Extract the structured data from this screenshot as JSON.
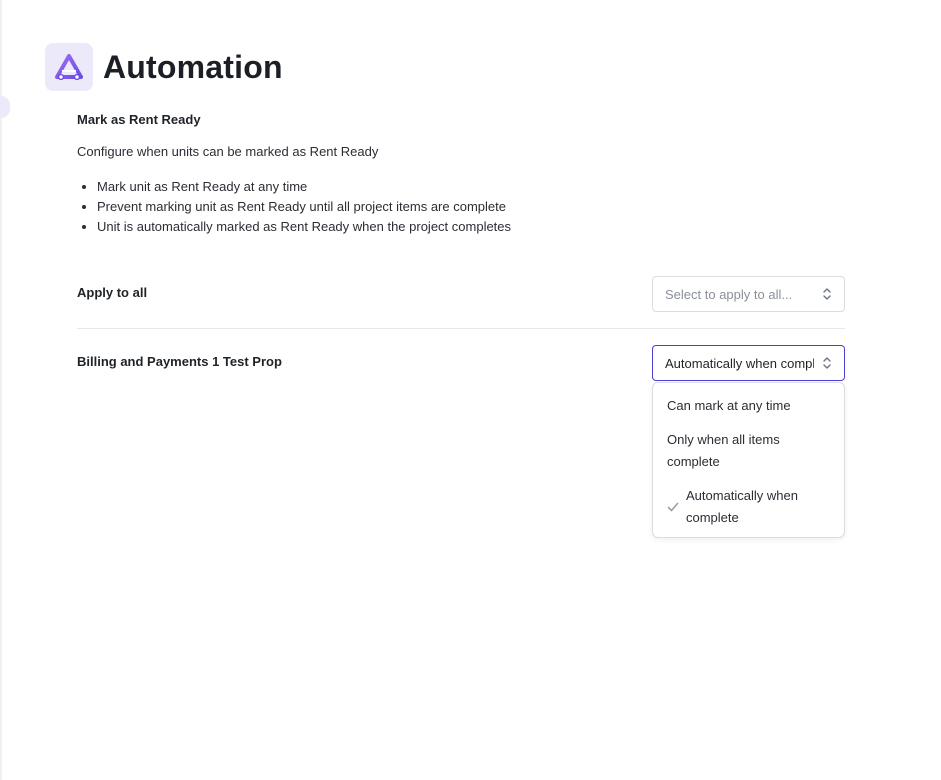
{
  "header": {
    "title": "Automation",
    "logo_icon": "triangle-logo-icon",
    "accent_color": "#8b5cf6"
  },
  "section": {
    "title": "Mark as Rent Ready",
    "description": "Configure when units can be marked as Rent Ready",
    "bullets": [
      "Mark unit as Rent Ready at any time",
      "Prevent marking unit as Rent Ready until all project items are complete",
      "Unit is automatically marked as Rent Ready when the project completes"
    ]
  },
  "apply_all": {
    "label": "Apply to all",
    "placeholder": "Select to apply to all..."
  },
  "property_row": {
    "label": "Billing and Payments 1 Test Prop",
    "selected_value": "Automatically when complete"
  },
  "dropdown": {
    "options": [
      {
        "label": "Can mark at any time",
        "selected": false
      },
      {
        "label": "Only when all items complete",
        "selected": false
      },
      {
        "label": "Automatically when complete",
        "selected": true
      }
    ]
  },
  "colors": {
    "focus_border": "#4c3fd1",
    "logo_bg": "#ece9fb"
  }
}
